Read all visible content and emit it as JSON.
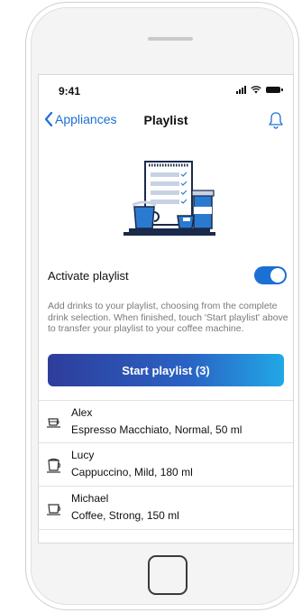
{
  "status_bar": {
    "time": "9:41"
  },
  "nav": {
    "back_label": "Appliances",
    "title": "Playlist"
  },
  "playlist": {
    "toggle_label": "Activate playlist",
    "toggle_on": true,
    "description": "Add drinks to your playlist, choosing from the complete drink selection. When finished, touch 'Start playlist' above to transfer your playlist to your coffee machine.",
    "start_button": "Start playlist (3)"
  },
  "items": [
    {
      "name": "Alex",
      "drink": "Espresso Macchiato, Normal, 50 ml",
      "icon": "espresso-cup-icon"
    },
    {
      "name": "Lucy",
      "drink": "Cappuccino, Mild, 180 ml",
      "icon": "cappuccino-cup-icon"
    },
    {
      "name": "Michael",
      "drink": "Coffee, Strong, 150 ml",
      "icon": "coffee-cup-icon"
    }
  ],
  "colors": {
    "accent": "#1c6fd4",
    "button_start": "#2e3d9c",
    "button_end": "#21a8e6"
  }
}
